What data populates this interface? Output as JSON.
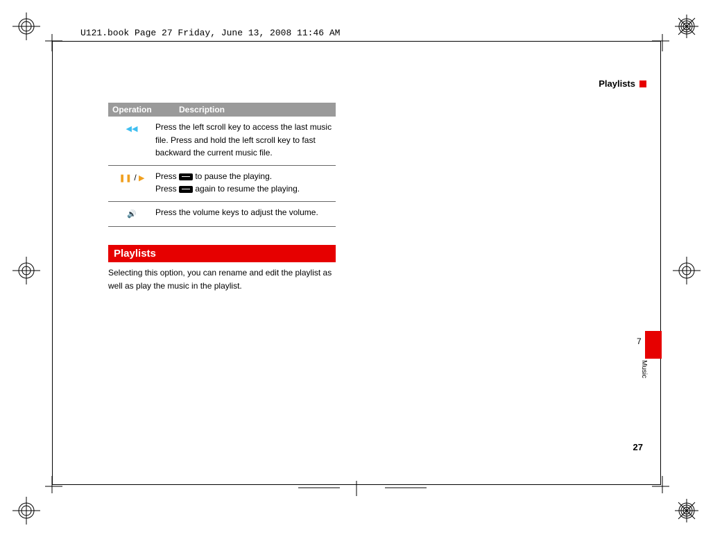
{
  "frame_label": "U121.book  Page 27  Friday, June 13, 2008  11:46 AM",
  "section_marker": "Playlists",
  "table": {
    "headers": {
      "c1": "Operation",
      "c2": "Description"
    },
    "rows": [
      {
        "icon": "rewind",
        "desc": "Press the left scroll key to access the last music file. Press and hold the left scroll key to fast backward the current music file."
      },
      {
        "icon": "pause-play",
        "desc_before1": "Press ",
        "desc_after1": " to pause the playing.",
        "desc_before2": "Press ",
        "desc_after2": " again to resume the playing."
      },
      {
        "icon": "volume",
        "desc": "Press the volume keys to adjust the volume."
      }
    ]
  },
  "playlists_heading": "Playlists",
  "playlists_desc": "Selecting this option, you can rename and edit the playlist as well as play the music in the playlist.",
  "side_tab": {
    "num": "7",
    "label": "Music"
  },
  "page_number": "27"
}
